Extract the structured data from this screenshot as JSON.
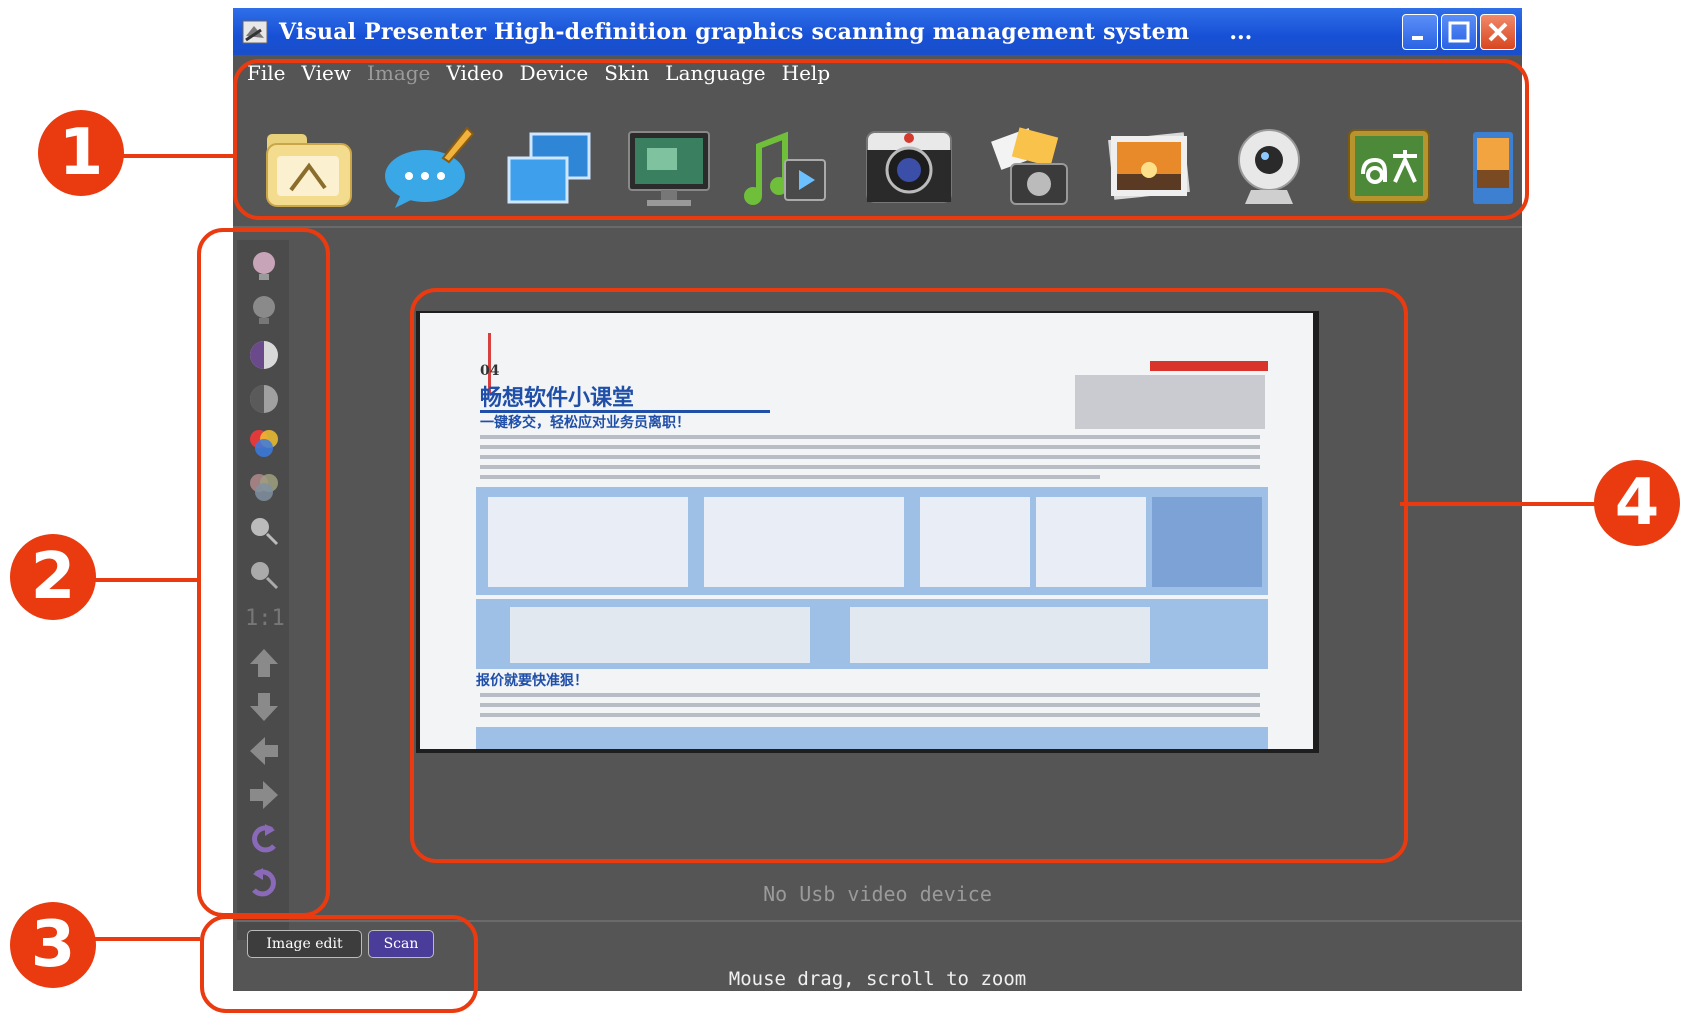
{
  "window": {
    "title": "Visual Presenter High-definition graphics scanning management system",
    "title_overflow": "...",
    "controls": [
      "minimize",
      "maximize",
      "close"
    ]
  },
  "menu": {
    "items": [
      {
        "label": "File",
        "enabled": true
      },
      {
        "label": "View",
        "enabled": true
      },
      {
        "label": "Image",
        "enabled": false
      },
      {
        "label": "Video",
        "enabled": true
      },
      {
        "label": "Device",
        "enabled": true
      },
      {
        "label": "Skin",
        "enabled": true
      },
      {
        "label": "Language",
        "enabled": true
      },
      {
        "label": "Help",
        "enabled": true
      }
    ]
  },
  "toolbar": {
    "icons": [
      "folder-icon",
      "annotate-icon",
      "dual-screen-icon",
      "monitor-icon",
      "media-icon",
      "camera-icon",
      "photo-capture-icon",
      "gallery-icon",
      "webcam-icon",
      "translate-icon",
      "slideshow-icon"
    ]
  },
  "sidebar": {
    "icons": [
      "brightness-up-icon",
      "brightness-down-icon",
      "contrast-up-icon",
      "contrast-down-icon",
      "color-saturation-up-icon",
      "color-saturation-down-icon",
      "zoom-in-icon",
      "zoom-out-icon",
      "actual-size-icon",
      "move-up-icon",
      "move-down-icon",
      "move-left-icon",
      "move-right-icon",
      "rotate-left-icon",
      "rotate-right-icon"
    ],
    "actual_size_label": "1:1"
  },
  "preview": {
    "page_number": "04",
    "headline": "畅想软件小课堂",
    "subheadline": "一键移交，轻松应对业务员离职！",
    "section_heading": "报价就要快准狠！"
  },
  "status": {
    "no_device": "No Usb video device",
    "hint": "Mouse drag, scroll to zoom"
  },
  "tabs": {
    "image_edit": "Image edit",
    "scan": "Scan"
  },
  "callouts": [
    "1",
    "2",
    "3",
    "4"
  ],
  "colors": {
    "callout": "#ea3b10",
    "titlebar": "#1750d6",
    "window_bg": "#555555",
    "scan_tab": "#4a3d9a"
  }
}
